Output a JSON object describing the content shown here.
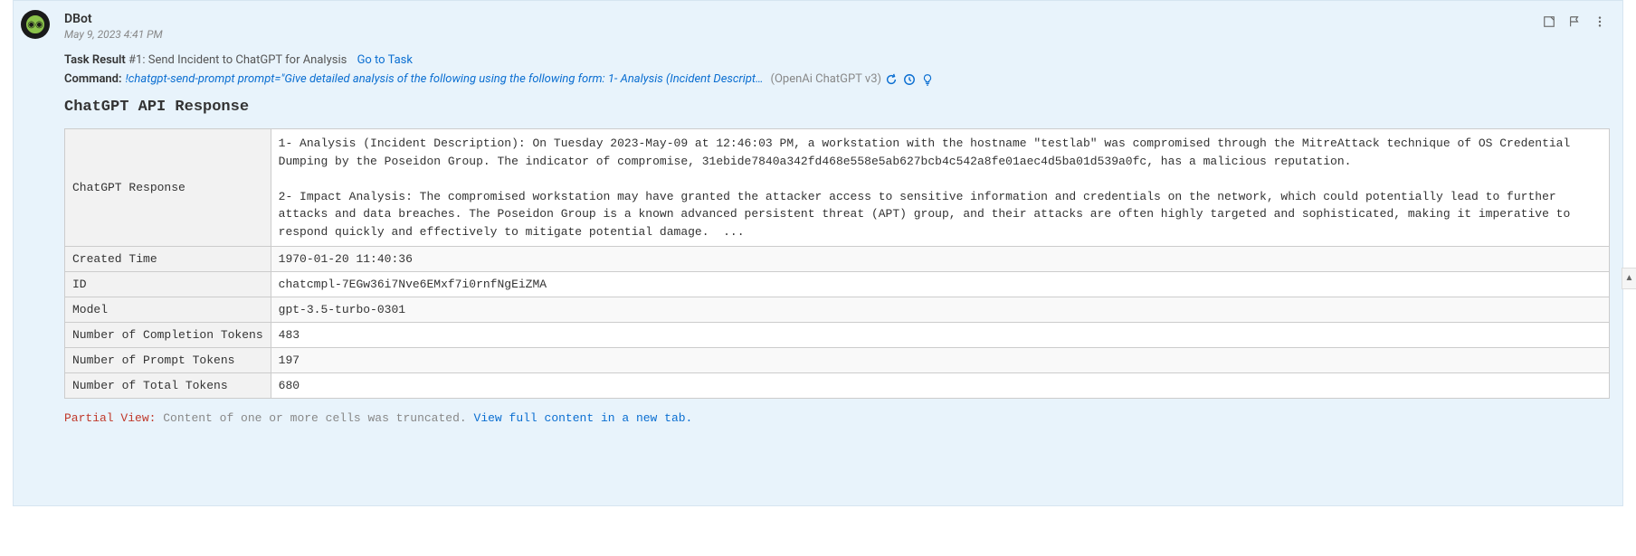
{
  "actions_label": "Actions",
  "user": "DBot",
  "timestamp": "May 9, 2023 4:41 PM",
  "task": {
    "label": "Task Result",
    "num": "#1:",
    "name": "Send Incident to ChatGPT for Analysis",
    "go": "Go to Task"
  },
  "command": {
    "label": "Command:",
    "text": "!chatgpt-send-prompt prompt=\"Give detailed analysis of the following using the following form: 1- Analysis (Incident Descript…",
    "source": "(OpenAi ChatGPT v3)"
  },
  "section_title": "ChatGPT API Response",
  "rows": {
    "r0k": "ChatGPT Response",
    "r0v": "1- Analysis (Incident Description): On Tuesday 2023-May-09 at 12:46:03 PM, a workstation with the hostname \"testlab\" was compromised through the MitreAttack technique of OS Credential Dumping by the Poseidon Group. The indicator of compromise, 31ebide7840a342fd468e558e5ab627bcb4c542a8fe01aec4d5ba01d539a0fc, has a malicious reputation.\n\n2- Impact Analysis: The compromised workstation may have granted the attacker access to sensitive information and credentials on the network, which could potentially lead to further attacks and data breaches. The Poseidon Group is a known advanced persistent threat (APT) group, and their attacks are often highly targeted and sophisticated, making it imperative to respond quickly and effectively to mitigate potential damage.  ...",
    "r1k": "Created Time",
    "r1v": "1970-01-20 11:40:36",
    "r2k": "ID",
    "r2v": "chatcmpl-7EGw36i7Nve6EMxf7i0rnfNgEiZMA",
    "r3k": "Model",
    "r3v": "gpt-3.5-turbo-0301",
    "r4k": "Number of Completion Tokens",
    "r4v": "483",
    "r5k": "Number of Prompt Tokens",
    "r5v": "197",
    "r6k": "Number of Total Tokens",
    "r6v": "680"
  },
  "partial": {
    "label": "Partial View:",
    "msg": "Content of one or more cells was truncated.",
    "link": "View full content in a new tab."
  }
}
